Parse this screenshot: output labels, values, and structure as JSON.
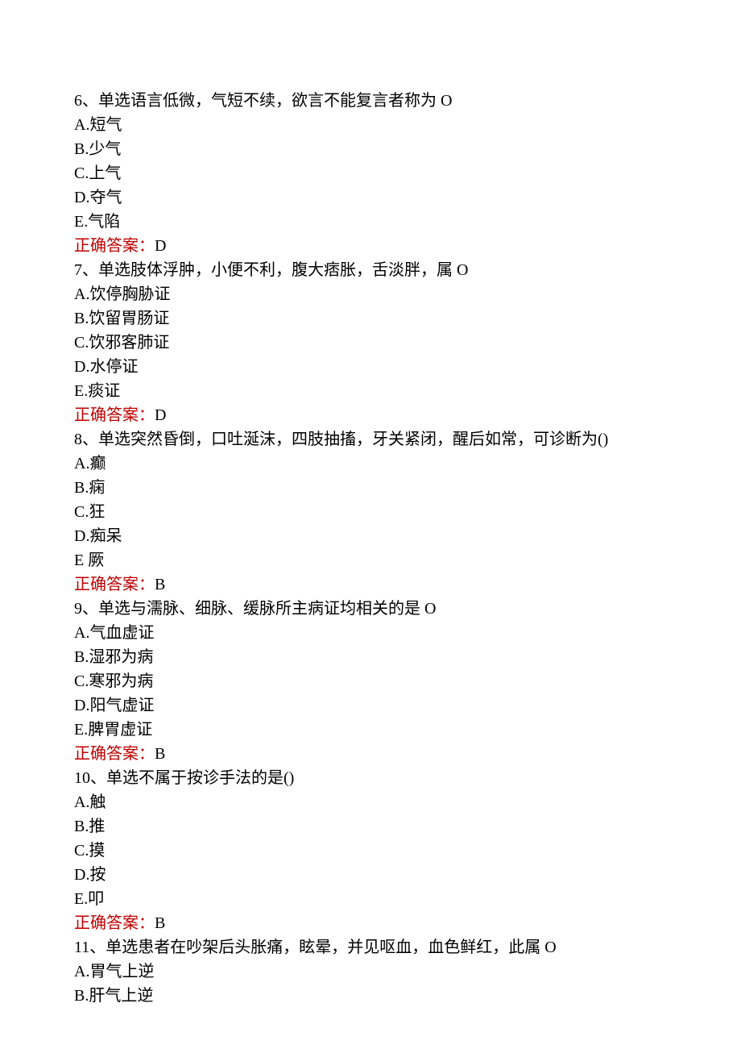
{
  "questions": [
    {
      "stem": "6、单选语言低微，气短不续，欲言不能复言者称为 O",
      "options": [
        "A.短气",
        "B.少气",
        "C.上气",
        "D.夺气",
        "E.气陷"
      ],
      "answer_label": "正确答案：",
      "answer_value": "D"
    },
    {
      "stem": "7、单选肢体浮肿，小便不利，腹大痞胀，舌淡胖，属 O",
      "options": [
        "A.饮停胸胁证",
        "B.饮留胃肠证",
        "C.饮邪客肺证",
        "D.水停证",
        "E.痰证"
      ],
      "answer_label": "正确答案：",
      "answer_value": "D"
    },
    {
      "stem": "8、单选突然昏倒，口吐涎沫，四肢抽搐，牙关紧闭，醒后如常，可诊断为()",
      "options": [
        "A.癫",
        "B.痫",
        "C.狂",
        "D.痴呆",
        "E 厥"
      ],
      "answer_label": "正确答案：",
      "answer_value": "B"
    },
    {
      "stem": "9、单选与濡脉、细脉、缓脉所主病证均相关的是 O",
      "options": [
        "A.气血虚证",
        "B.湿邪为病",
        "C.寒邪为病",
        "D.阳气虚证",
        "E.脾胃虚证"
      ],
      "answer_label": "正确答案：",
      "answer_value": "B"
    },
    {
      "stem": "10、单选不属于按诊手法的是()",
      "options": [
        "A.触",
        "B.推",
        "C.摸",
        "D.按",
        "E.叩"
      ],
      "answer_label": "正确答案：",
      "answer_value": "B"
    },
    {
      "stem": "11、单选患者在吵架后头胀痛，眩晕，并见呕血，血色鲜红，此属 O",
      "options": [
        "A.胃气上逆",
        "B.肝气上逆"
      ],
      "answer_label": null,
      "answer_value": null
    }
  ]
}
